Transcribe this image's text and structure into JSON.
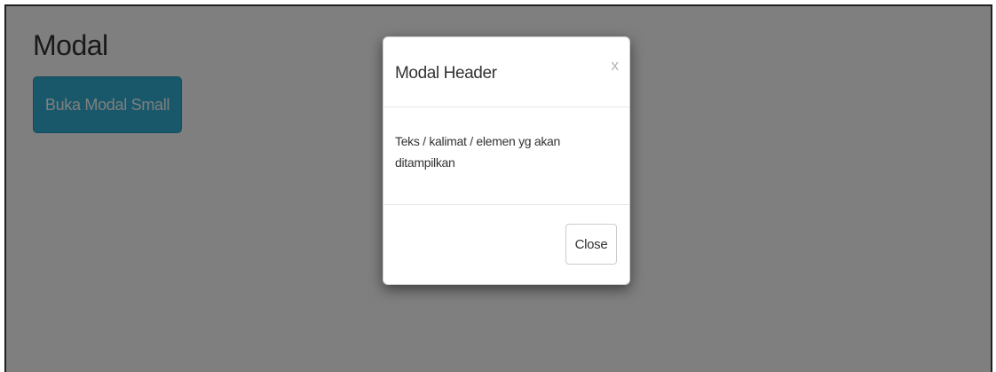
{
  "page": {
    "title": "Modal",
    "open_button_label": "Buka Modal Small"
  },
  "modal": {
    "title": "Modal Header",
    "close_x": "x",
    "body_text": "Teks / kalimat / elemen yg akan ditampilkan",
    "footer_button_label": "Close"
  },
  "colors": {
    "info_button": "#31b0d5",
    "backdrop": "#000000",
    "backdrop_opacity": "0.5"
  },
  "icons": {
    "close": "close-icon"
  }
}
